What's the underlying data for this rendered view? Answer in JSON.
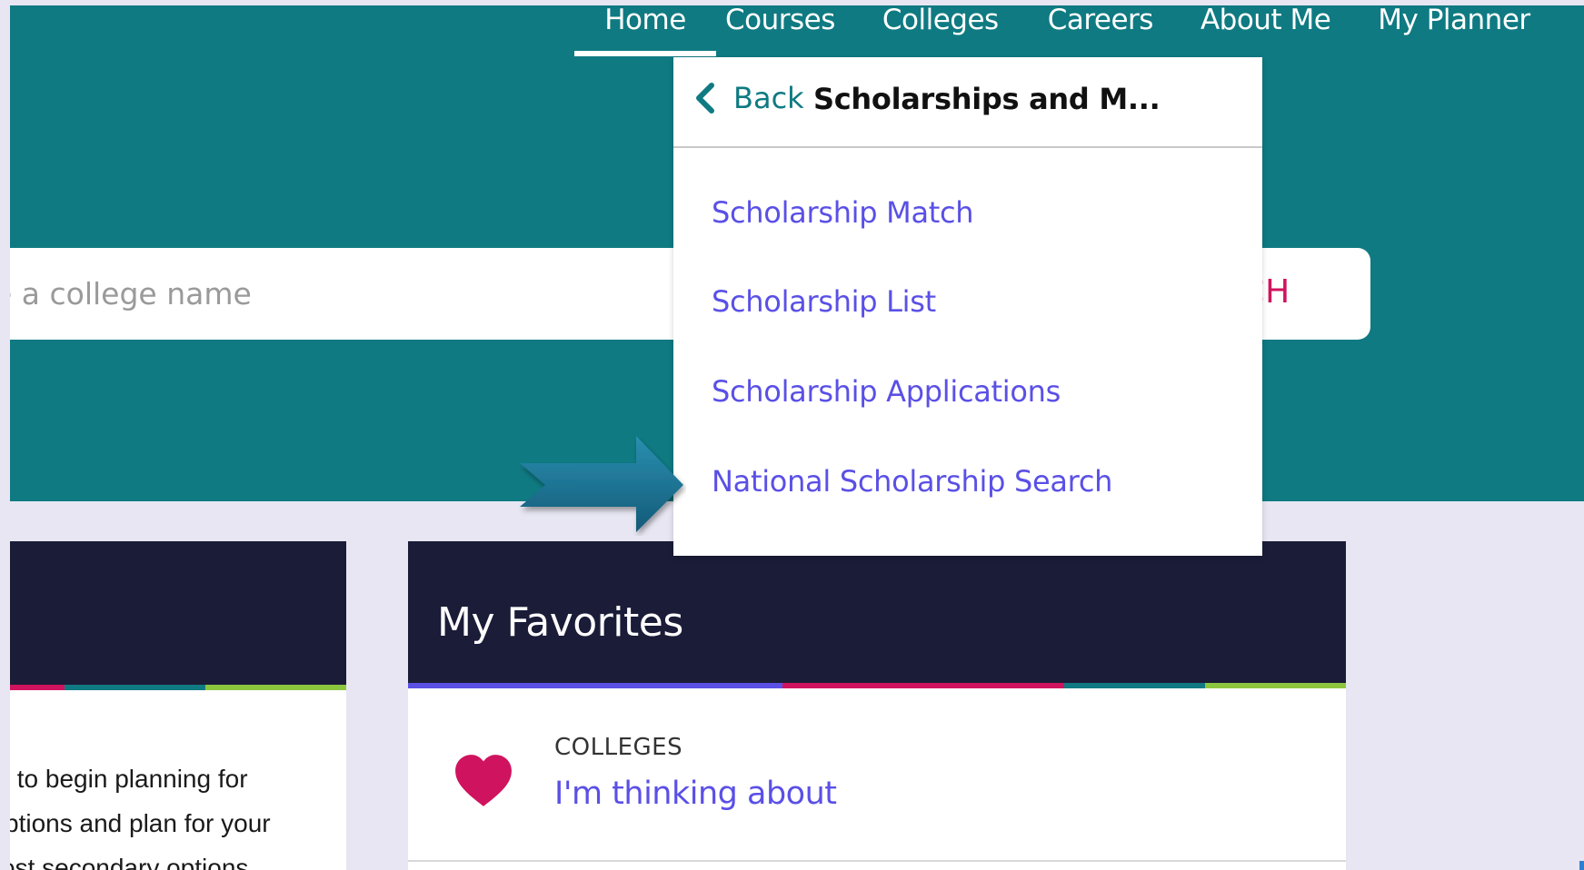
{
  "nav": {
    "items": [
      "Home",
      "Courses",
      "Colleges",
      "Careers",
      "About Me",
      "My Planner"
    ],
    "active": "Home"
  },
  "search": {
    "placeholder": "e a college name",
    "button_label": "CH"
  },
  "dropdown": {
    "back_label": "Back",
    "title": "Scholarships and M...",
    "items": [
      "Scholarship Match",
      "Scholarship List",
      "Scholarship Applications",
      "National Scholarship Search"
    ]
  },
  "left_card": {
    "lines": [
      " to begin planning for",
      "ptions and plan for your",
      "ost secondary options"
    ]
  },
  "favorites": {
    "title": "My Favorites",
    "category": "COLLEGES",
    "link": "I'm thinking about"
  },
  "colors": {
    "teal": "#0f7a82",
    "navy": "#1b1c38",
    "link_purple": "#5a50e6",
    "magenta": "#d0135e",
    "lime": "#8cc63f",
    "page_bg": "#e7e6f2"
  }
}
